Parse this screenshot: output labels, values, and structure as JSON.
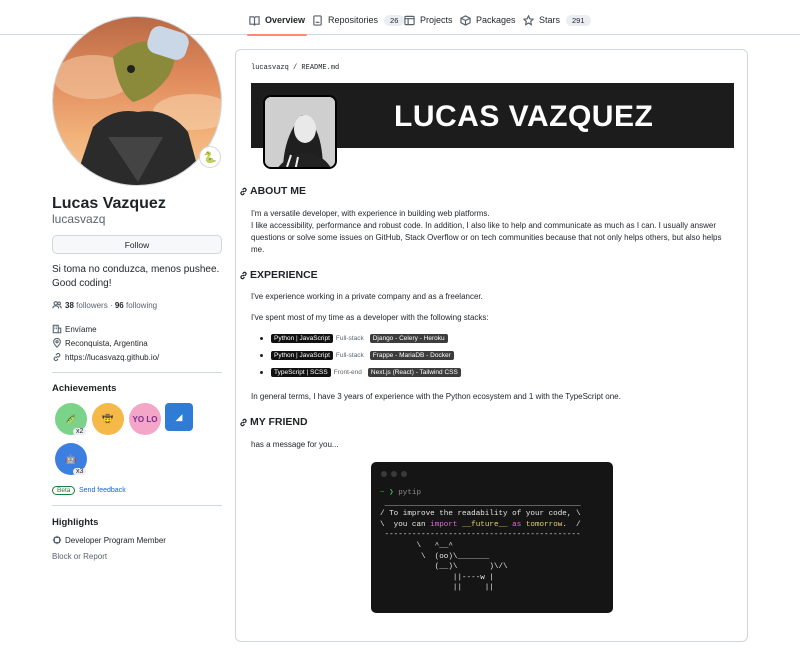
{
  "tabs": [
    {
      "label": "Overview",
      "count": ""
    },
    {
      "label": "Repositories",
      "count": "26"
    },
    {
      "label": "Projects",
      "count": ""
    },
    {
      "label": "Packages",
      "count": ""
    },
    {
      "label": "Stars",
      "count": "291"
    }
  ],
  "profile": {
    "full_name": "Lucas Vazquez",
    "username": "lucasvazq",
    "status_emoji": "🐍",
    "follow_label": "Follow",
    "bio_line1": "Si toma no conduzca, menos pushee.",
    "bio_line2": "Good coding!",
    "followers_count": "38",
    "followers_label": "followers",
    "separator": "·",
    "following_count": "96",
    "following_label": "following",
    "company": "Envíame",
    "location": "Reconquista, Argentina",
    "website": "https://lucasvazq.github.io/"
  },
  "achievements": {
    "title": "Achievements",
    "badges": [
      {
        "name": "pair-extraordinaire",
        "count": "x2",
        "color": "#7bd389"
      },
      {
        "name": "starstruck",
        "count": "",
        "color": "#f5b94a"
      },
      {
        "name": "yolo",
        "count": "",
        "color": "#f4a6c8"
      },
      {
        "name": "quickdraw",
        "count": "",
        "color": "#2e7cd6"
      },
      {
        "name": "arctic-code-vault",
        "count": "x3",
        "color": "#3d7fe0"
      }
    ],
    "badge_texts": [
      "🫛",
      "🤠",
      "YO LO",
      "◢",
      "🤖"
    ],
    "beta_label": "Beta",
    "feedback_label": "Send feedback"
  },
  "highlights": {
    "title": "Highlights",
    "items": [
      "Developer Program Member"
    ],
    "block_label": "Block or Report"
  },
  "readme": {
    "breadcrumb_user": "lucasvazq",
    "breadcrumb_sep": "/",
    "breadcrumb_file": "README.md",
    "banner_name": "LUCAS VAZQUEZ",
    "about_title": "ABOUT ME",
    "about_p1": "I'm a versatile developer, with experience in building web platforms.",
    "about_p2": "I like accessibility, performance and robust code. In addition, I also like to help and communicate as much as I can. I usually answer questions or solve some issues on GitHub, Stack Overflow or on tech communities because that not only helps others, but also helps me.",
    "experience_title": "EXPERIENCE",
    "exp_p1": "I've experience working in a private company and as a freelancer.",
    "exp_p2": "I've spent most of my time as a developer with the following stacks:",
    "stacks": [
      {
        "lang": "Python | JavaScript",
        "type": "Full-stack",
        "tech": "Django - Celery - Heroku"
      },
      {
        "lang": "Python | JavaScript",
        "type": "Full-stack",
        "tech": "Frappe - MariaDB - Docker"
      },
      {
        "lang": "TypeScript | SCSS",
        "type": "Front-end",
        "tech": "Next.js (React) - Tailwind CSS"
      }
    ],
    "exp_p3": "In general terms, I have 3 years of experience with the Python ecosystem and 1 with the TypeScript one.",
    "friend_title": "MY FRIEND",
    "friend_p": "has a message for you...",
    "terminal": {
      "prompt": "~ ❯",
      "command": "pytip",
      "line1": "/ To improve the readability of your code, \\",
      "line2_pre": "\\  you can ",
      "line2_kw": "import",
      "line2_mid": " __future__ ",
      "line2_as": "as",
      "line2_word": "tomorrow",
      "line2_end": ".  /",
      "cow": "        \\   ^__^\n         \\  (oo)\\_______\n            (__)\\       )\\/\\\n                ||----w |\n                ||     ||"
    }
  }
}
